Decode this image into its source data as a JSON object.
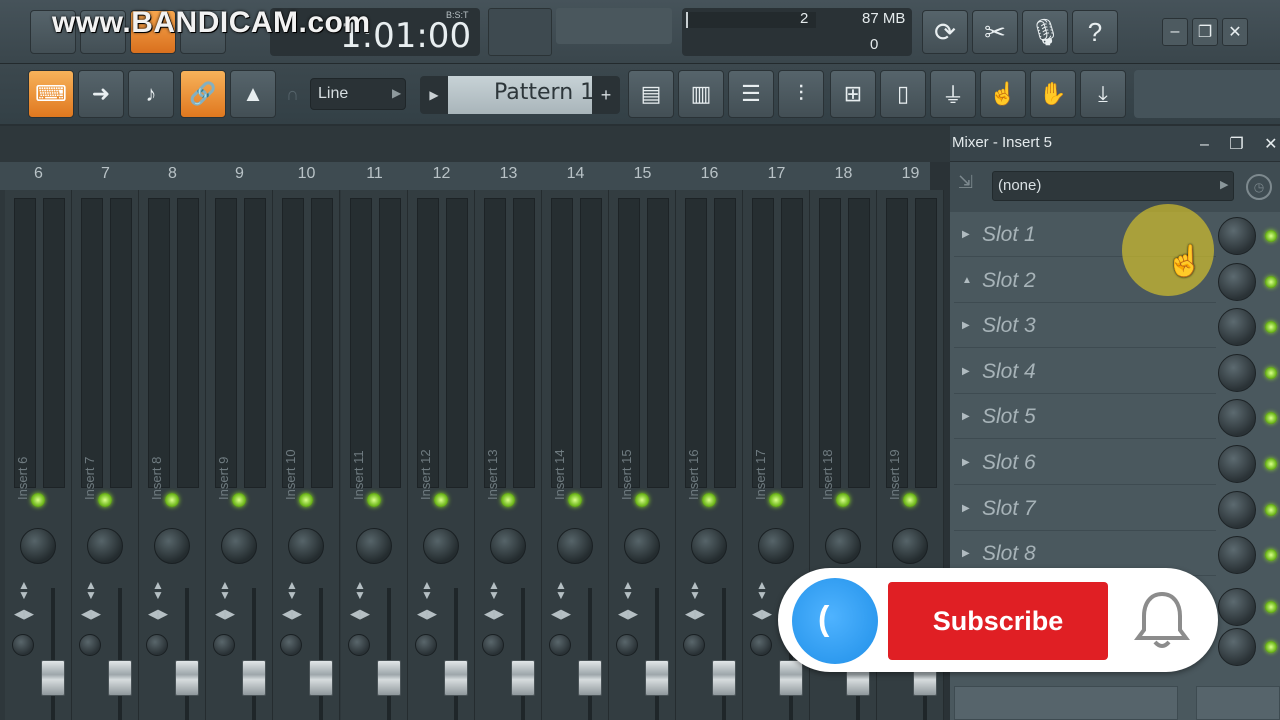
{
  "watermark": "www.BANDICAM.com",
  "transport": {
    "time": "1:01:00",
    "bst_label": "B:S:T"
  },
  "monitor": {
    "cpu_count": "2",
    "memory": "87 MB",
    "voices": "0"
  },
  "toolbar": {
    "snap_value": "Line",
    "pattern_name": "Pattern 1",
    "add_pattern": "+"
  },
  "window_controls": {
    "minimize": "–",
    "restore": "❐",
    "close": "✕"
  },
  "mixer": {
    "title": "Mixer - Insert 5",
    "tracks": [
      {
        "num": "6",
        "name": "Insert 6"
      },
      {
        "num": "7",
        "name": "Insert 7"
      },
      {
        "num": "8",
        "name": "Insert 8"
      },
      {
        "num": "9",
        "name": "Insert 9"
      },
      {
        "num": "10",
        "name": "Insert 10"
      },
      {
        "num": "11",
        "name": "Insert 11"
      },
      {
        "num": "12",
        "name": "Insert 12"
      },
      {
        "num": "13",
        "name": "Insert 13"
      },
      {
        "num": "14",
        "name": "Insert 14"
      },
      {
        "num": "15",
        "name": "Insert 15"
      },
      {
        "num": "16",
        "name": "Insert 16"
      },
      {
        "num": "17",
        "name": "Insert 17"
      },
      {
        "num": "18",
        "name": "Insert 18"
      },
      {
        "num": "19",
        "name": "Insert 19"
      }
    ]
  },
  "insert_panel": {
    "input_select": "(none)",
    "slots": [
      "Slot 1",
      "Slot 2",
      "Slot 3",
      "Slot 4",
      "Slot 5",
      "Slot 6",
      "Slot 7",
      "Slot 8"
    ]
  },
  "overlay": {
    "subscribe_label": "Subscribe"
  },
  "colors": {
    "accent_orange": "#e0781f",
    "led_green": "#6fb81c",
    "subscribe_red": "#e01f24",
    "avatar_blue": "#1f8fe8"
  }
}
